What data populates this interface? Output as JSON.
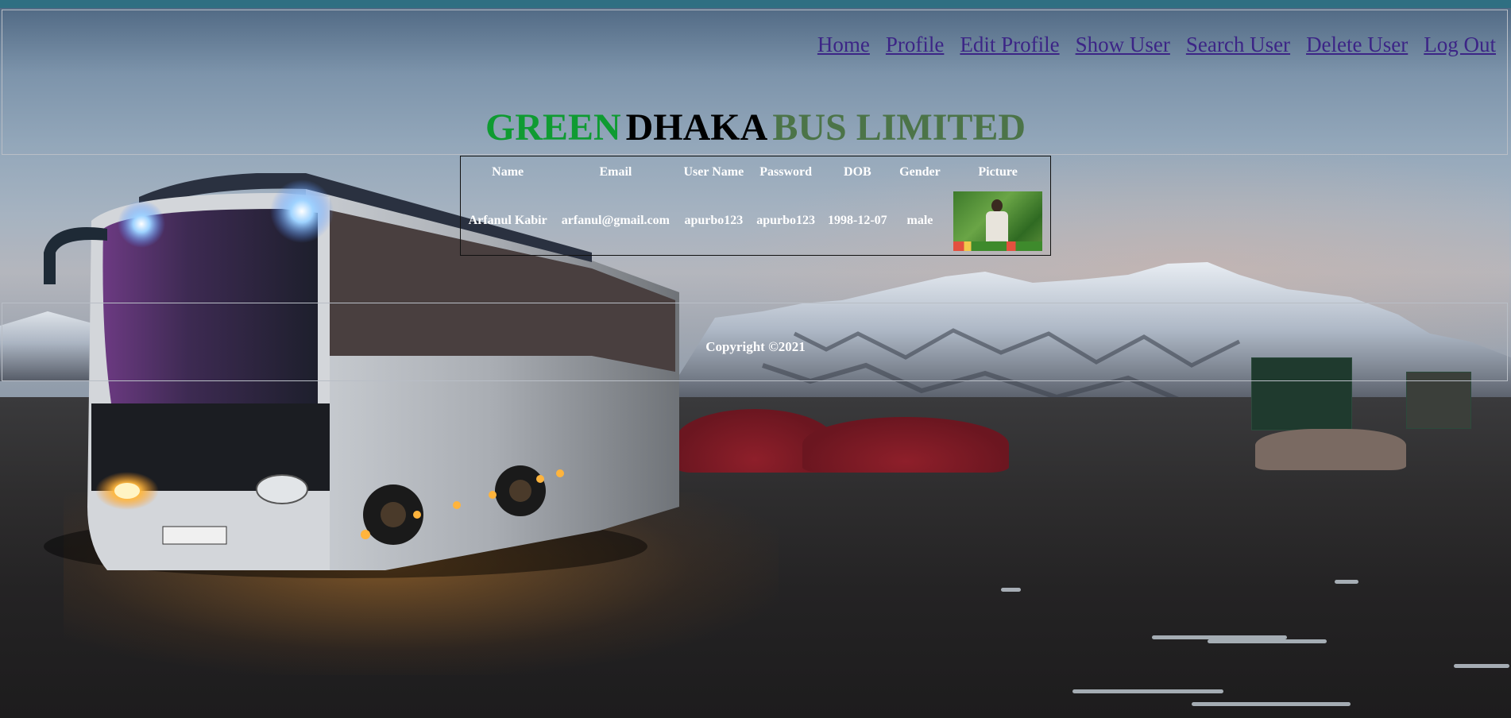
{
  "nav": {
    "items": [
      "Home",
      "Profile",
      "Edit Profile",
      "Show User",
      "Search User",
      "Delete User",
      "Log Out"
    ]
  },
  "brand": {
    "part1": "GREEN",
    "part2": "DHAKA",
    "part3": "BUS LIMITED",
    "colors": {
      "part1": "#0f9b32",
      "part2": "#000000",
      "part3": "#4c7448"
    }
  },
  "user_table": {
    "headers": [
      "Name",
      "Email",
      "User Name",
      "Password",
      "DOB",
      "Gender",
      "Picture"
    ],
    "row": {
      "name": "Arfanul Kabir",
      "email": "arfanul@gmail.com",
      "username": "apurbo123",
      "password": "apurbo123",
      "dob": "1998-12-07",
      "gender": "male",
      "picture": "profile-photo"
    }
  },
  "footer": {
    "copyright": "Copyright ©2021"
  },
  "colors": {
    "link": "#3c2586",
    "panel_border": "#b9bec6"
  }
}
